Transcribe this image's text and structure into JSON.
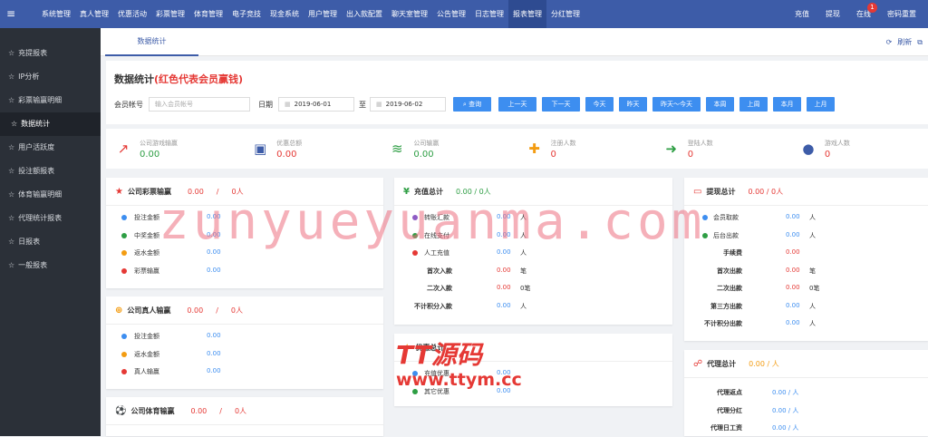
{
  "topbar": {
    "nav": [
      "系统管理",
      "真人管理",
      "优惠活动",
      "彩票管理",
      "体育管理",
      "电子竞技",
      "现金系统",
      "用户管理",
      "出入款配置",
      "聊天室管理",
      "公告管理",
      "日志管理",
      "报表管理",
      "分红管理"
    ],
    "active_index": 12,
    "right": {
      "recharge": "充值",
      "withdraw": "提现",
      "online": "在线",
      "online_count": "1",
      "reset_password": "密码重置"
    }
  },
  "sidebar": {
    "items": [
      "充提报表",
      "IP分析",
      "彩票输赢明细",
      "数据统计",
      "用户活跃度",
      "投注额报表",
      "体育输赢明细",
      "代理统计报表",
      "日报表",
      "一般报表"
    ],
    "active_index": 3
  },
  "tab": {
    "label": "数据统计",
    "refresh": "刷新"
  },
  "panel": {
    "title": "数据统计",
    "subtitle": "(红色代表会员赢钱)",
    "member_label": "会员帐号",
    "member_placeholder": "输入会员帐号",
    "date_label": "日期",
    "date_from": "2019-06-01",
    "to_label": "至",
    "date_to": "2019-06-02",
    "query_btn": "查询",
    "buttons": [
      "上一天",
      "下一天",
      "今天",
      "昨天",
      "昨天～今天",
      "本周",
      "上周",
      "本月",
      "上月"
    ]
  },
  "stats": [
    {
      "label": "公司游戏输赢",
      "value": "0.00",
      "color": "#2e9e44",
      "icon": "line-chart-icon",
      "icon_color": "#e53935"
    },
    {
      "label": "优惠总额",
      "value": "0.00",
      "color": "#e53935",
      "icon": "money-bill-icon",
      "icon_color": "#3d5ca8"
    },
    {
      "label": "公司输赢",
      "value": "0.00",
      "color": "#2e9e44",
      "icon": "database-icon",
      "icon_color": "#2e9e44"
    },
    {
      "label": "注册人数",
      "value": "0",
      "color": "#e53935",
      "icon": "user-plus-icon",
      "icon_color": "#f39c12"
    },
    {
      "label": "登陆人数",
      "value": "0",
      "color": "#e53935",
      "icon": "sign-in-icon",
      "icon_color": "#2e9e44"
    },
    {
      "label": "游戏人数",
      "value": "0",
      "color": "#e53935",
      "icon": "user-icon",
      "icon_color": "#3d5ca8"
    }
  ],
  "lottery": {
    "title": "公司彩票输赢",
    "value": "0.00",
    "slash": "/",
    "count": "0人",
    "rows": [
      {
        "label": "投注金额",
        "value": "0.00",
        "dot": "#3d8ef0"
      },
      {
        "label": "中奖金额",
        "value": "0.00",
        "dot": "#2e9e44"
      },
      {
        "label": "返水金额",
        "value": "0.00",
        "dot": "#f39c12"
      },
      {
        "label": "彩票输赢",
        "value": "0.00",
        "dot": "#e53935"
      }
    ]
  },
  "live": {
    "title": "公司真人输赢",
    "value": "0.00",
    "slash": "/",
    "count": "0人",
    "rows": [
      {
        "label": "投注金额",
        "value": "0.00",
        "dot": "#3d8ef0"
      },
      {
        "label": "返水金额",
        "value": "0.00",
        "dot": "#f39c12"
      },
      {
        "label": "真人输赢",
        "value": "0.00",
        "dot": "#e53935"
      }
    ]
  },
  "sports": {
    "title": "公司体育输赢",
    "value": "0.00",
    "slash": "/",
    "count": "0人"
  },
  "recharge": {
    "title": "充值总计",
    "summary": "0.00 / 0人",
    "rows": [
      {
        "label": "转账汇款",
        "value": "0.00",
        "unit": "人",
        "dot": "#8e5bc4",
        "color": "#3d8ef0"
      },
      {
        "label": "在线支付",
        "value": "0.00",
        "unit": "人",
        "dot": "#2e9e44",
        "color": "#3d8ef0"
      },
      {
        "label": "人工充值",
        "value": "0.00",
        "unit": "人",
        "dot": "#e53935",
        "color": "#3d8ef0"
      }
    ],
    "brows": [
      {
        "label": "首次入款",
        "value": "0.00",
        "unit": "笔",
        "color": "#e53935"
      },
      {
        "label": "二次入款",
        "value": "0.00",
        "unit": "0笔",
        "color": "#e53935"
      },
      {
        "label": "不计积分入款",
        "value": "0.00",
        "unit": "人",
        "color": "#3d8ef0"
      }
    ]
  },
  "promo": {
    "title": "优惠总计",
    "rows": [
      {
        "label": "充值优惠",
        "value": "0.00",
        "dot": "#3d8ef0"
      },
      {
        "label": "其它优惠",
        "value": "0.00",
        "dot": "#2e9e44"
      }
    ]
  },
  "withdraw": {
    "title": "提现总计",
    "summary": "0.00 / 0人",
    "rows": [
      {
        "label": "会员取款",
        "value": "0.00",
        "unit": "人",
        "dot": "#3d8ef0"
      },
      {
        "label": "后台出款",
        "value": "0.00",
        "unit": "人",
        "dot": "#2e9e44"
      }
    ],
    "brows": [
      {
        "label": "手续费",
        "value": "0.00",
        "unit": "",
        "color": "#e53935"
      },
      {
        "label": "首次出款",
        "value": "0.00",
        "unit": "笔",
        "color": "#e53935"
      },
      {
        "label": "二次出款",
        "value": "0.00",
        "unit": "0笔",
        "color": "#e53935"
      },
      {
        "label": "第三方出款",
        "value": "0.00",
        "unit": "人",
        "color": "#3d8ef0"
      },
      {
        "label": "不计积分出款",
        "value": "0.00",
        "unit": "人",
        "color": "#3d8ef0"
      }
    ]
  },
  "agent": {
    "title": "代理总计",
    "summary": "0.00 / 人",
    "rows": [
      {
        "label": "代理返点",
        "value": "0.00 / 人"
      },
      {
        "label": "代理分红",
        "value": "0.00 / 人"
      },
      {
        "label": "代理日工资",
        "value": "0.00 / 人"
      }
    ]
  },
  "watermark": {
    "text": "zunyueyuanma.com",
    "logo_line1": "TT源码",
    "logo_line2": "www.ttym.cc"
  }
}
